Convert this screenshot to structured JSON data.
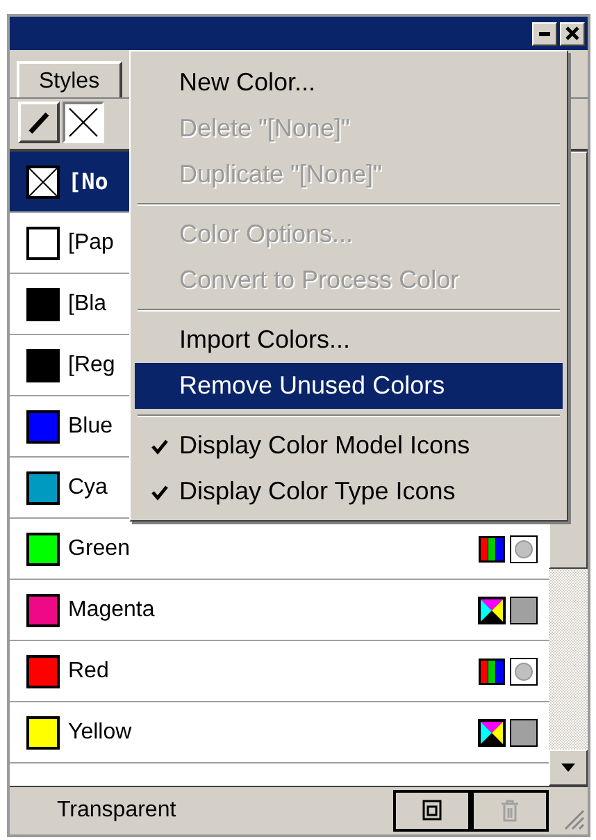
{
  "tabs": [
    {
      "label": "Styles",
      "selected": true
    }
  ],
  "toolbar": [
    {
      "kind": "pencil",
      "selected": true
    },
    {
      "kind": "none",
      "selected": false
    }
  ],
  "swatches": [
    {
      "name": "[No",
      "kind": "none",
      "selected": true
    },
    {
      "name": "[Pap",
      "kind": "color",
      "color": "#ffffff",
      "selected": false
    },
    {
      "name": "[Bla",
      "kind": "color",
      "color": "#000000",
      "selected": false
    },
    {
      "name": "[Reg",
      "kind": "color",
      "color": "#000000",
      "selected": false
    },
    {
      "name": "Blue",
      "kind": "color",
      "color": "#0000ff",
      "selected": false
    },
    {
      "name": "Cya",
      "kind": "color",
      "color": "#0099c0",
      "selected": false
    },
    {
      "name": "Green",
      "kind": "color",
      "color": "#00ff00",
      "selected": false,
      "icons": [
        {
          "kind": "rgb"
        },
        {
          "kind": "spot"
        }
      ]
    },
    {
      "name": "Magenta",
      "kind": "color",
      "color": "#ee0a84",
      "selected": false,
      "icons": [
        {
          "kind": "cmyk"
        },
        {
          "kind": "process"
        }
      ]
    },
    {
      "name": "Red",
      "kind": "color",
      "color": "#ff0000",
      "selected": false,
      "icons": [
        {
          "kind": "rgb"
        },
        {
          "kind": "spot"
        }
      ]
    },
    {
      "name": "Yellow",
      "kind": "color",
      "color": "#ffff00",
      "selected": false,
      "icons": [
        {
          "kind": "cmyk"
        },
        {
          "kind": "process"
        }
      ]
    }
  ],
  "status": "Transparent",
  "bottom_buttons": [
    {
      "kind": "new",
      "disabled": false
    },
    {
      "kind": "delete",
      "disabled": true
    }
  ],
  "menu": [
    {
      "kind": "item",
      "label": "New Color...",
      "disabled": false,
      "selected": false
    },
    {
      "kind": "item",
      "label": "Delete \"[None]\"",
      "disabled": true,
      "selected": false
    },
    {
      "kind": "item",
      "label": "Duplicate \"[None]\"",
      "disabled": true,
      "selected": false
    },
    {
      "kind": "separator"
    },
    {
      "kind": "item",
      "label": "Color Options...",
      "disabled": true,
      "selected": false
    },
    {
      "kind": "item",
      "label": "Convert to Process Color",
      "disabled": true,
      "selected": false
    },
    {
      "kind": "separator"
    },
    {
      "kind": "item",
      "label": "Import Colors...",
      "disabled": false,
      "selected": false
    },
    {
      "kind": "item",
      "label": "Remove Unused Colors",
      "disabled": false,
      "selected": true
    },
    {
      "kind": "separator"
    },
    {
      "kind": "check",
      "label": "Display Color Model Icons",
      "checked": true,
      "disabled": false,
      "selected": false
    },
    {
      "kind": "check",
      "label": "Display Color Type Icons",
      "checked": true,
      "disabled": false,
      "selected": false
    }
  ]
}
